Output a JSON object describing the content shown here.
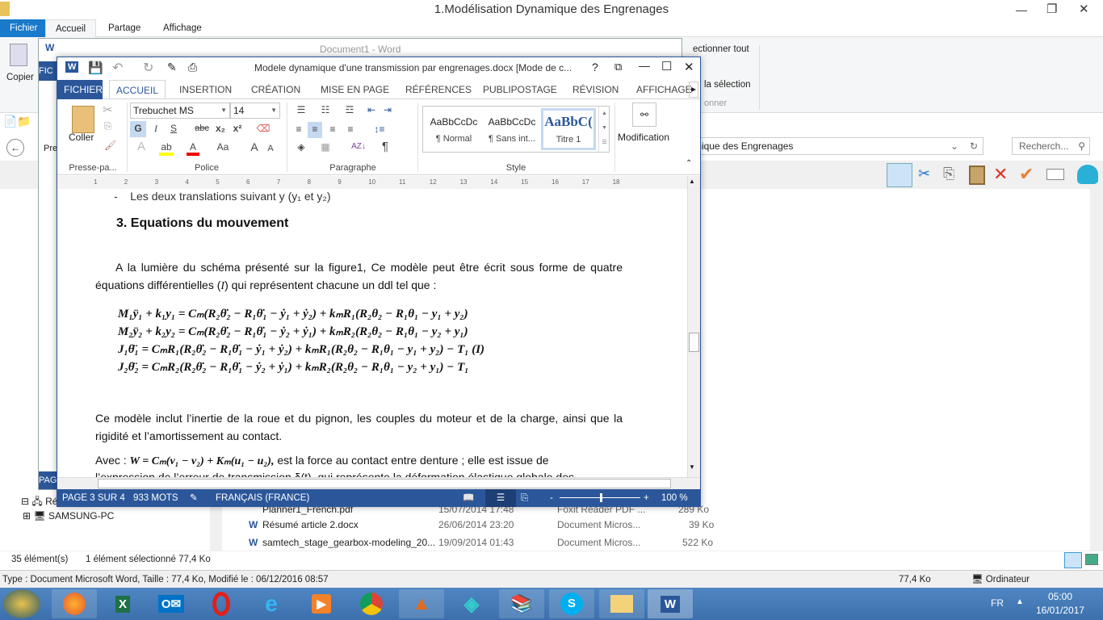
{
  "explorer": {
    "title": "1.Modélisation Dynamique des Engrenages",
    "tabs": [
      "Fichier",
      "Accueil",
      "Partage",
      "Affichage"
    ],
    "ribbon": {
      "copy": "Copier",
      "select_all": "ectionner tout",
      "invert": "la sélection",
      "group": "onner"
    },
    "address": "mique des Engrenages",
    "search_placeholder": "Recherch...",
    "tree": {
      "network": "Rése",
      "pc": "SAMSUNG-PC"
    },
    "files": [
      {
        "name": "Planner1_French.pdf",
        "date": "15/07/2014 17:48",
        "type": "Foxit Reader PDF ...",
        "size": "289 Ko"
      },
      {
        "name": "Résumé article 2.docx",
        "date": "26/06/2014 23:20",
        "type": "Document Micros...",
        "size": "39 Ko"
      },
      {
        "name": "samtech_stage_gearbox-modeling_20...",
        "date": "19/09/2014 01:43",
        "type": "Document Micros...",
        "size": "522 Ko"
      }
    ],
    "status": {
      "count": "35 élément(s)",
      "selected": "1 élément sélectionné  77,4 Ko"
    },
    "info": {
      "details": "Type : Document Microsoft Word, Taille : 77,4 Ko, Modifié le : 06/12/2016 08:57",
      "size": "77,4 Ko",
      "location": "Ordinateur"
    }
  },
  "word_back": {
    "title": "Document1 - Word",
    "tab": "FIC",
    "pre": "Pre",
    "status": "PAG"
  },
  "word": {
    "title": "Modele dynamique d'une transmission par engrenages.docx [Mode de c...",
    "tabs": [
      "FICHIER",
      "ACCUEIL",
      "INSERTION",
      "CRÉATION",
      "MISE EN PAGE",
      "RÉFÉRENCES",
      "PUBLIPOSTAGE",
      "RÉVISION",
      "AFFICHAGE"
    ],
    "active_tab": "ACCUEIL",
    "ribbon": {
      "paste": "Coller",
      "font": "Trebuchet MS",
      "size": "14",
      "bold": "G",
      "italic": "I",
      "underline": "S",
      "strike": "abc",
      "sub": "x₂",
      "sup": "x²",
      "grow": "A",
      "case": "Aa",
      "styles": [
        {
          "preview": "AaBbCcDc",
          "name": "¶ Normal"
        },
        {
          "preview": "AaBbCcDc",
          "name": "¶ Sans int..."
        },
        {
          "preview": "AaBbC(",
          "name": "Titre 1"
        }
      ],
      "editing": "Modification",
      "groups": [
        "Presse-pa...",
        "Police",
        "Paragraphe",
        "Style"
      ]
    },
    "ruler": [
      "1",
      "2",
      "3",
      "4",
      "5",
      "6",
      "7",
      "8",
      "9",
      "10",
      "11",
      "12",
      "13",
      "14",
      "15",
      "16",
      "17",
      "18"
    ],
    "doc": {
      "bullet": "Les deux translations suivant y  (y₁ et  y₂)",
      "heading": "3.  Equations du mouvement",
      "p1a": "A la lumière du schéma présenté sur la figure1, Ce modèle peut être écrit sous forme de quatre  équations différentielles (",
      "p1var": "I",
      "p1b": ") qui représentent chacune un ddl tel que :",
      "equations": [
        "M₁ÿ₁ + k₁y₁ = Cₘ(R₂θ̇₂ − R₁θ̇₁ − ẏ₁ + ẏ₂) + kₘR₁(R₂θ₂ − R₁θ₁ − y₁ + y₂)",
        "M₂ÿ₂ + k₂y₂ = Cₘ(R₂θ̇₂ − R₁θ̇₁ − ẏ₂ + ẏ₁) + kₘR₂(R₂θ₂ − R₁θ₁ − y₂ + y₁)",
        "J₁θ̈₁ = CₘR₁(R₂θ̇₂ − R₁θ̇₁ − ẏ₁ + ẏ₂) + kₘR₁(R₂θ₂ − R₁θ₁ − y₁ + y₂) − T₁   (I)",
        "J₂θ̈₂ = CₘR₂(R₂θ̇₂ − R₁θ̇₁ − ẏ₂ + ẏ₁) + kₘR₂(R₂θ₂ − R₁θ₁ − y₂ + y₁) − T₁"
      ],
      "p2": "Ce modèle inclut l’inertie de la roue et du pignon, les couples du moteur et de la  charge, ainsi que la rigidité et l’amortissement au contact.",
      "p3a": "Avec : ",
      "p3eq": "W = Cₘ(v₁ − v₂) + Kₘ(u₁ − u₂),",
      "p3b": " est la force au contact entre denture ; elle est issue de",
      "p4": "l’expression de  l’erreur de transmission δ(t), qui représente la déformation élastique globale des"
    },
    "status": {
      "page": "PAGE 3 SUR 4",
      "words": "933 MOTS",
      "lang": "FRANÇAIS (FRANCE)",
      "zoom": "100 %",
      "zoom_value": 100
    }
  },
  "taskbar": {
    "lang": "FR",
    "time": "05:00",
    "date": "16/01/2017",
    "apps": [
      "Firefox",
      "Excel",
      "Outlook",
      "Opera",
      "Internet Explorer",
      "Media Player",
      "Chrome",
      "MATLAB",
      "App",
      "WinRAR",
      "Skype",
      "Explorateur",
      "Word"
    ]
  },
  "colors": {
    "word_blue": "#2b579a",
    "explorer_blue": "#1979ca",
    "taskbar": "#3c70ad"
  }
}
